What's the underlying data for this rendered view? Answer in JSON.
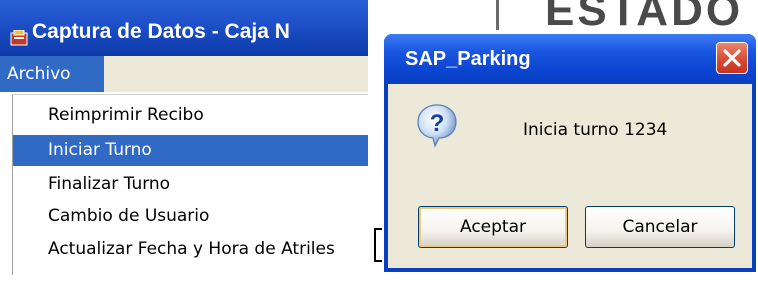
{
  "left_window": {
    "title": "Captura de Datos - Caja N",
    "menubar": {
      "archivo_label": "Archivo"
    },
    "dropdown": [
      {
        "label": "Reimprimir Recibo",
        "highlighted": false
      },
      {
        "label": "Iniciar Turno",
        "highlighted": true
      },
      {
        "label": "Finalizar Turno",
        "highlighted": false
      },
      {
        "label": "Cambio de Usuario",
        "highlighted": false
      },
      {
        "label": "Actualizar Fecha y Hora de Atriles",
        "highlighted": false
      }
    ]
  },
  "background": {
    "estado_text": "ESTADO"
  },
  "dialog": {
    "title": "SAP_Parking",
    "message": "Inicia turno 1234",
    "icon": "question-icon",
    "buttons": {
      "ok_label": "Aceptar",
      "cancel_label": "Cancelar"
    }
  },
  "colors": {
    "titlebar_blue": "#0a3fc0",
    "menu_highlight": "#316ac5",
    "dialog_body": "#ece9d8",
    "close_button_red": "#d9503a"
  }
}
